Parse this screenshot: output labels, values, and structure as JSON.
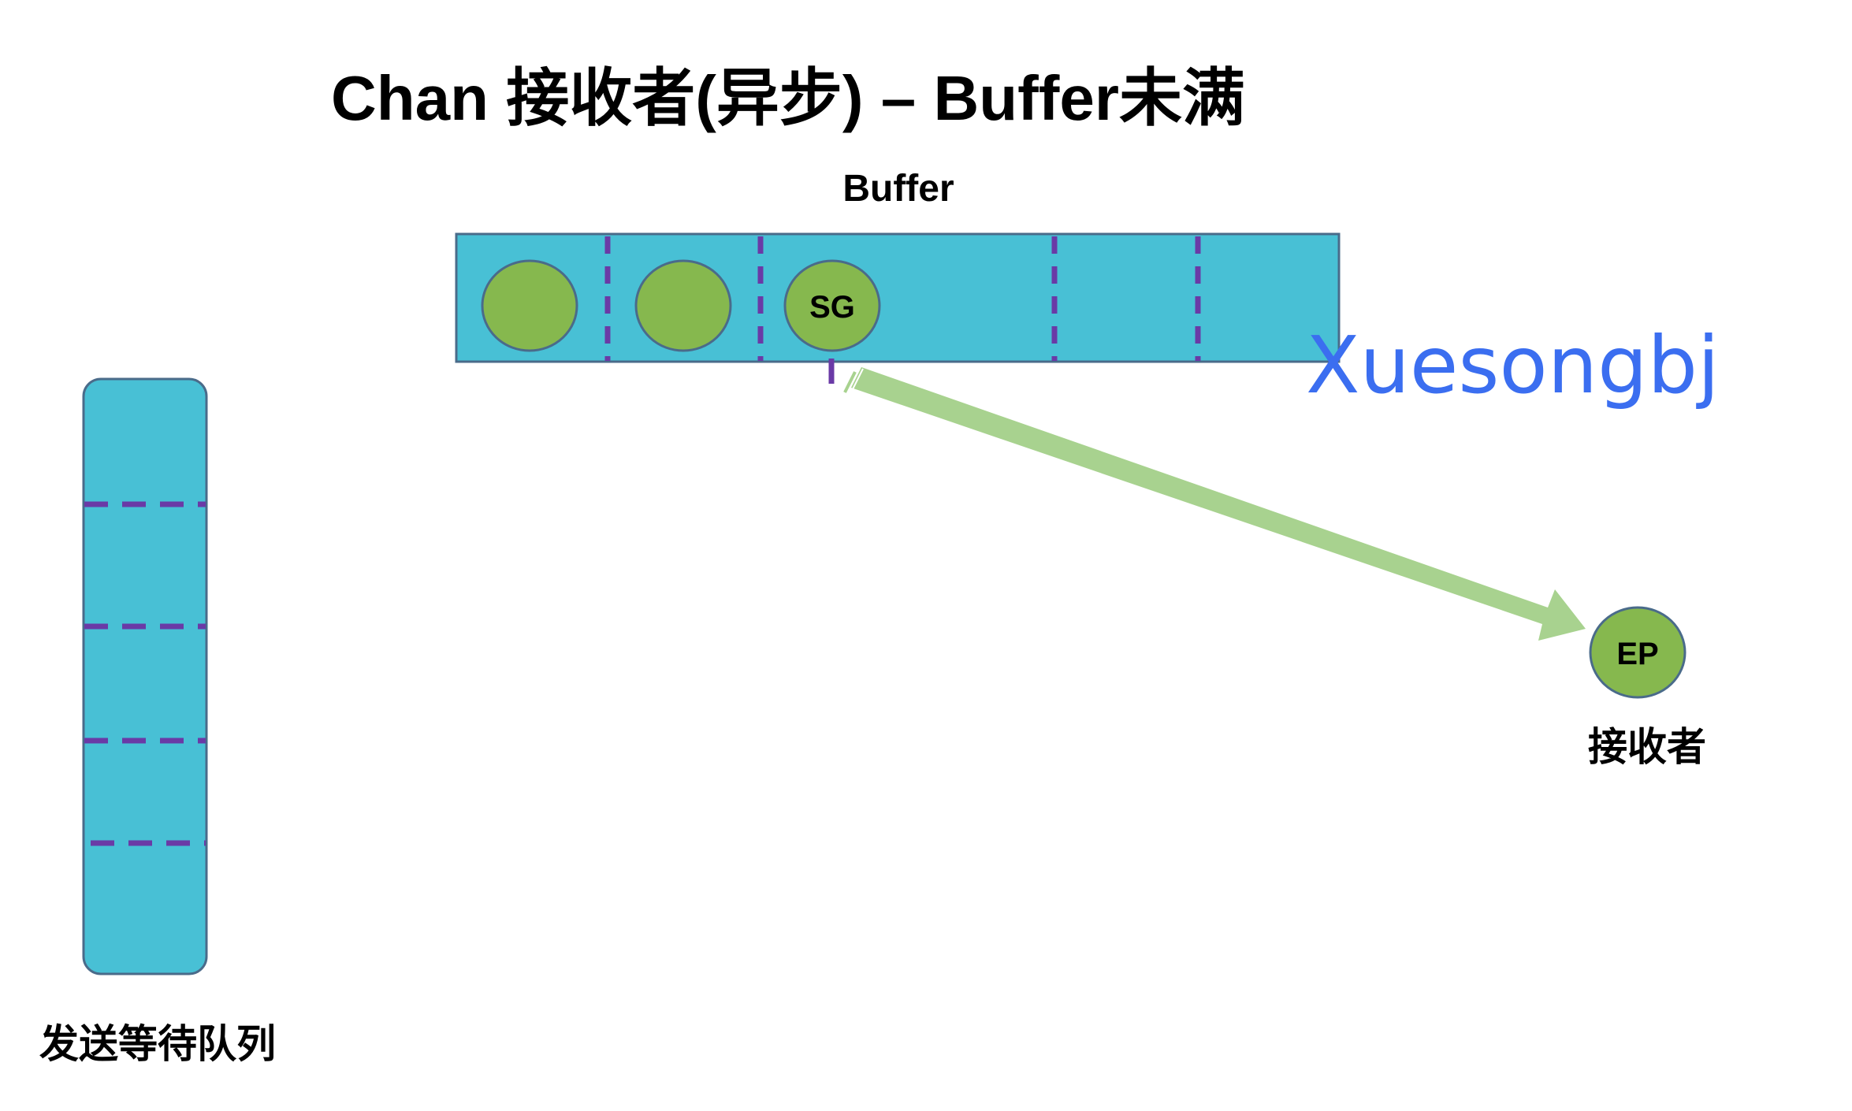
{
  "title": "Chan 接收者(异步) – Buffer未满",
  "buffer": {
    "label": "Buffer",
    "slots": 6,
    "items": [
      "",
      "",
      "SG"
    ]
  },
  "receiver": {
    "node_label": "EP",
    "caption": "接收者"
  },
  "send_queue": {
    "caption": "发送等待队列",
    "slots": 5
  },
  "watermark": "Xuesongbj",
  "colors": {
    "buffer_fill": "#48c0d5",
    "divider": "#6a3aa6",
    "node_fill": "#86b84e",
    "node_stroke": "#4a6b8a",
    "arrow": "#a8d28f",
    "watermark": "#3b6ef0"
  }
}
